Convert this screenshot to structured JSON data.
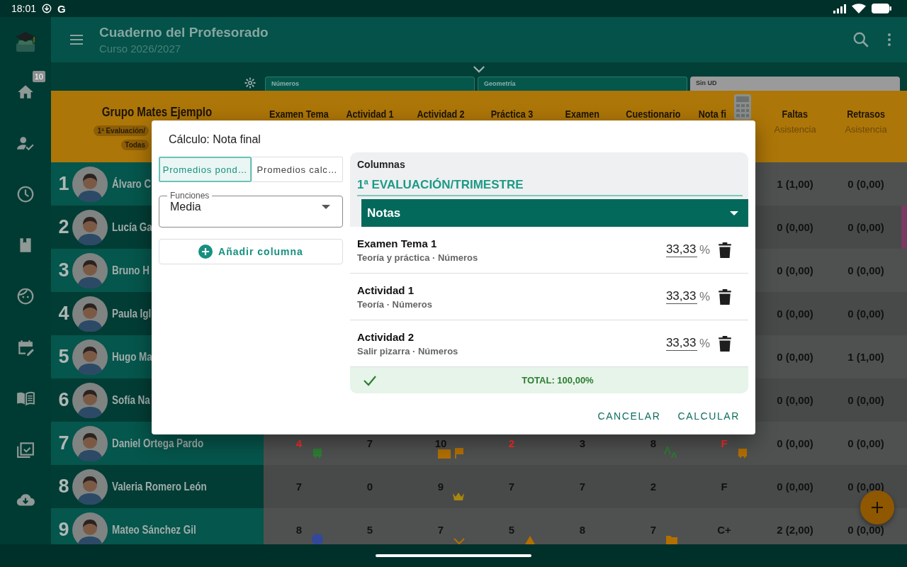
{
  "status_bar": {
    "time": "18:01",
    "app_letter": "G"
  },
  "app_bar": {
    "title": "Cuaderno del Profesorado",
    "subtitle": "Curso 2026/2027"
  },
  "nav_rail": [
    {
      "kind": "logo"
    },
    {
      "kind": "home",
      "badge": "10"
    },
    {
      "kind": "person_check"
    },
    {
      "kind": "clock"
    },
    {
      "kind": "bookmark"
    },
    {
      "kind": "face"
    },
    {
      "kind": "calendar_edit"
    },
    {
      "kind": "book"
    },
    {
      "kind": "calendar_check"
    },
    {
      "kind": "cloud_download"
    }
  ],
  "units": [
    {
      "label": "Números",
      "kind": "unit"
    },
    {
      "label": "Geometría",
      "kind": "unit"
    },
    {
      "label": "Sin UD",
      "kind": "none"
    }
  ],
  "table": {
    "group": "Grupo Mates Ejemplo",
    "chips": [
      "1ª Evaluación/",
      "Todas"
    ],
    "columns": [
      {
        "label": "Examen Tema",
        "calculator": false
      },
      {
        "label": "Actividad 1",
        "calculator": false
      },
      {
        "label": "Actividad 2",
        "calculator": false
      },
      {
        "label": "Práctica 3",
        "calculator": false
      },
      {
        "label": "Examen",
        "calculator": false
      },
      {
        "label": "Cuestionario",
        "calculator": false
      },
      {
        "label": "Nota fi",
        "calculator": true
      },
      {
        "label": "Faltas",
        "sublabel": "Asistencia",
        "calculator": false
      },
      {
        "label": "Retrasos",
        "sublabel": "Asistencia",
        "calculator": false
      }
    ],
    "rows": [
      {
        "number": "1",
        "name": "Álvaro C",
        "flagged": false,
        "faltas": "1 (1,00)",
        "retrasos": "0 (0,00)"
      },
      {
        "number": "2",
        "name": "Lucía Ga",
        "flagged": true,
        "faltas": "0 (0,00)",
        "retrasos": "0 (0,00)"
      },
      {
        "number": "3",
        "name": "Bruno H",
        "flagged": false,
        "faltas": "0 (0,00)",
        "retrasos": "0 (0,00)"
      },
      {
        "number": "4",
        "name": "Paula Igl",
        "flagged": false,
        "faltas": "0 (0,00)",
        "retrasos": "0 (0,00)"
      },
      {
        "number": "5",
        "name": "Hugo Ma",
        "flagged": false,
        "faltas": "0 (0,00)",
        "retrasos": "1 (1,00)"
      },
      {
        "number": "6",
        "name": "Sofía Na",
        "flagged": false,
        "faltas": "0 (0,00)",
        "retrasos": "0 (0,00)"
      },
      {
        "number": "7",
        "name": "Daniel Ortega Pardo",
        "flagged": false,
        "faltas": "0 (0,00)",
        "retrasos": "0 (0,00)",
        "grades": [
          {
            "value": "4",
            "failing": true,
            "icons": [
              {
                "kind": "bus",
                "color": "#2e7d32"
              }
            ]
          },
          {
            "value": "7",
            "failing": false
          },
          {
            "value": "10",
            "failing": false,
            "icons": [
              {
                "kind": "mail",
                "color": "#b36f00"
              },
              {
                "kind": "flag",
                "color": "#b36f00"
              }
            ]
          },
          {
            "value": "2",
            "failing": true
          },
          {
            "value": "3",
            "failing": false
          },
          {
            "value": "8",
            "failing": false,
            "icons": [
              {
                "kind": "font",
                "color": "#2e7d32"
              }
            ]
          },
          {
            "value": "F",
            "failing": true,
            "icons": [
              {
                "kind": "bus",
                "color": "#b36f00"
              }
            ]
          }
        ]
      },
      {
        "number": "8",
        "name": "Valeria Romero León",
        "flagged": false,
        "faltas": "0 (0,00)",
        "retrasos": "0 (0,00)",
        "grades": [
          {
            "value": "7",
            "failing": false
          },
          {
            "value": "0",
            "failing": false
          },
          {
            "value": "9",
            "failing": false,
            "icons": [
              {
                "kind": "crown",
                "color": "#a8870e"
              }
            ]
          },
          {
            "value": "7",
            "failing": false
          },
          {
            "value": "7",
            "failing": false
          },
          {
            "value": "2",
            "failing": false
          },
          {
            "value": "F",
            "failing": false
          }
        ]
      },
      {
        "number": "9",
        "name": "Mateo Sánchez Gil",
        "flagged": false,
        "faltas": "2 (2,00)",
        "retrasos": "0 (0,00)",
        "grades": [
          {
            "value": "8",
            "failing": false,
            "icons": [
              {
                "kind": "dot",
                "color": "#34489a"
              }
            ]
          },
          {
            "value": "5",
            "failing": false
          },
          {
            "value": "7",
            "failing": false,
            "icons": [
              {
                "kind": "chevron",
                "color": "#b36f00"
              }
            ]
          },
          {
            "value": "5",
            "failing": false,
            "icons": [
              {
                "kind": "triangle",
                "color": "#b36f00"
              }
            ]
          },
          {
            "value": "8",
            "failing": false
          },
          {
            "value": "7",
            "failing": false,
            "icons": [
              {
                "kind": "folder",
                "color": "#b36f00"
              }
            ]
          },
          {
            "value": "C+",
            "failing": false
          }
        ]
      }
    ]
  },
  "dialog": {
    "title": "Cálculo: Nota final",
    "modes": [
      {
        "label": "Promedios pond…",
        "selected": true
      },
      {
        "label": "Promedios calc…",
        "selected": false
      }
    ],
    "function_field": {
      "label": "Funciones",
      "value": "Media"
    },
    "add_button": "Añadir columna",
    "columns_panel": {
      "label": "Columnas",
      "section": "1ª EVALUACIÓN/TRIMESTRE",
      "group": "Notas",
      "items": [
        {
          "name": "Examen Tema 1",
          "detail": "Teoría y práctica · Números",
          "weight": "33,33",
          "unit": "%"
        },
        {
          "name": "Actividad 1",
          "detail": "Teoría · Números",
          "weight": "33,33",
          "unit": "%"
        },
        {
          "name": "Actividad 2",
          "detail": "Salir pizarra · Números",
          "weight": "33,33",
          "unit": "%"
        }
      ],
      "total": "TOTAL: 100,00%",
      "valid": true
    },
    "buttons": [
      "CANCELAR",
      "CALCULAR"
    ]
  }
}
